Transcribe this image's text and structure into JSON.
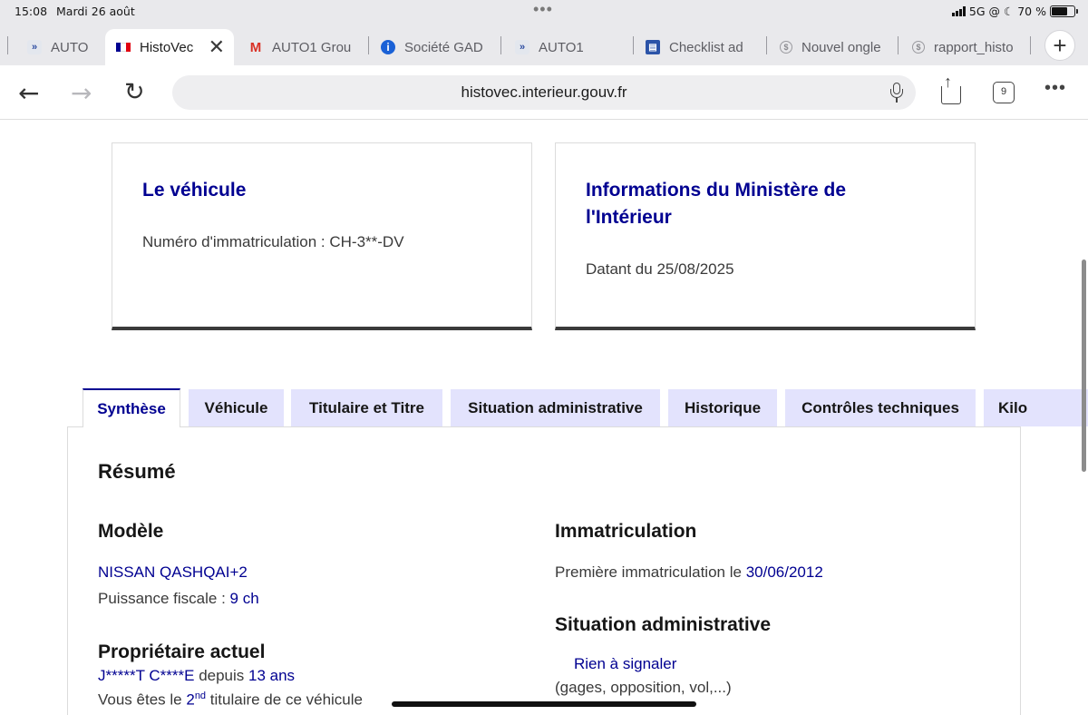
{
  "status_bar": {
    "time": "15:08",
    "date": "Mardi 26 août",
    "network": "5G",
    "battery": "70 %",
    "battery_level": 0.7
  },
  "browser": {
    "tabs": [
      {
        "label": "AUTO",
        "icon": "auto1-favicon"
      },
      {
        "label": "HistoVec",
        "icon": "french-flag-favicon",
        "active": true
      },
      {
        "label": "AUTO1 Grou",
        "icon": "gmail-icon"
      },
      {
        "label": "Société GAD",
        "icon": "info-icon"
      },
      {
        "label": "AUTO1",
        "icon": "auto1-favicon"
      },
      {
        "label": "Checklist ad",
        "icon": "checklist-icon"
      },
      {
        "label": "Nouvel ongle",
        "icon": "globe-icon"
      },
      {
        "label": "rapport_histo",
        "icon": "globe-icon"
      }
    ],
    "url": "histovec.interieur.gouv.fr",
    "tab_count": "9"
  },
  "page": {
    "vehicle_card": {
      "title": "Le véhicule",
      "plate_label": "Numéro d'immatriculation : CH-3**-DV"
    },
    "ministry_card": {
      "title_line1": "Informations du Ministère de",
      "title_line2": "l'Intérieur",
      "date_label": "Datant du 25/08/2025"
    },
    "tabs": [
      "Synthèse",
      "Véhicule",
      "Titulaire et Titre",
      "Situation administrative",
      "Historique",
      "Contrôles techniques",
      "Kilo"
    ],
    "summary": {
      "title": "Résumé",
      "model": {
        "heading": "Modèle",
        "name": "NISSAN QASHQAI+2",
        "power_label": "Puissance fiscale : ",
        "power_value": "9 ch"
      },
      "registration": {
        "heading": "Immatriculation",
        "first_label": "Première immatriculation le ",
        "first_date": "30/06/2012"
      },
      "owner": {
        "heading": "Propriétaire actuel",
        "name": "J*****T C****E",
        "since_label": " depuis ",
        "since_value": "13 ans",
        "rank_prefix": "Vous êtes le ",
        "rank_num": "2",
        "rank_sup": "nd",
        "rank_suffix": " titulaire de ce véhicule"
      },
      "admin": {
        "heading": "Situation administrative",
        "status": "Rien à signaler",
        "detail": "(gages, opposition, vol,...)"
      }
    }
  },
  "colors": {
    "brand_blue": "#000091",
    "tab_bg": "#e3e3fd",
    "browser_chrome": "#e9e9ec"
  }
}
